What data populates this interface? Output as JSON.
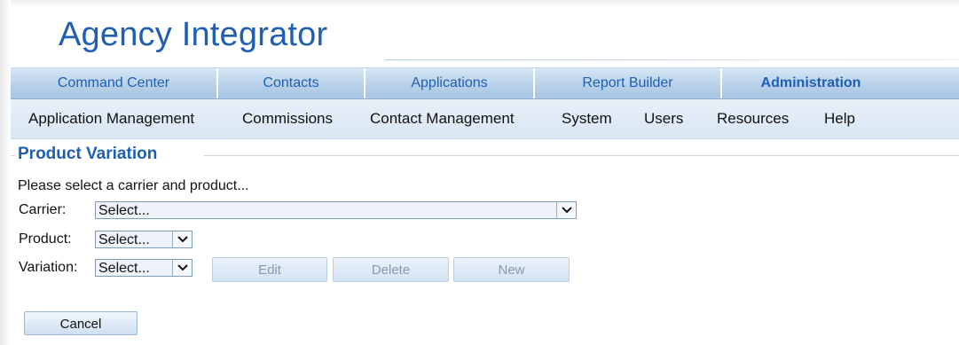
{
  "app": {
    "title": "Agency Integrator"
  },
  "tabs": [
    {
      "label": "Command Center",
      "active": false
    },
    {
      "label": "Contacts",
      "active": false
    },
    {
      "label": "Applications",
      "active": false
    },
    {
      "label": "Report Builder",
      "active": false
    },
    {
      "label": "Administration",
      "active": true
    }
  ],
  "subnav": [
    {
      "label": "Application Management"
    },
    {
      "label": "Commissions"
    },
    {
      "label": "Contact Management"
    },
    {
      "label": "System"
    },
    {
      "label": "Users"
    },
    {
      "label": "Resources"
    },
    {
      "label": "Help"
    }
  ],
  "section": {
    "title": "Product Variation"
  },
  "form": {
    "instruction": "Please select a carrier and product...",
    "carrier": {
      "label": "Carrier:",
      "value": "Select..."
    },
    "product": {
      "label": "Product:",
      "value": "Select..."
    },
    "variation": {
      "label": "Variation:",
      "value": "Select..."
    }
  },
  "buttons": {
    "edit": {
      "label": "Edit",
      "enabled": false
    },
    "delete": {
      "label": "Delete",
      "enabled": false
    },
    "new": {
      "label": "New",
      "enabled": false
    },
    "cancel": {
      "label": "Cancel",
      "enabled": true
    }
  },
  "colors": {
    "brand_blue": "#1f5fb3",
    "tab_bar": "#b8d1ea",
    "subnav_bar": "#e1ebf6"
  },
  "icons": {
    "dropdown": "chevron-down-icon"
  }
}
